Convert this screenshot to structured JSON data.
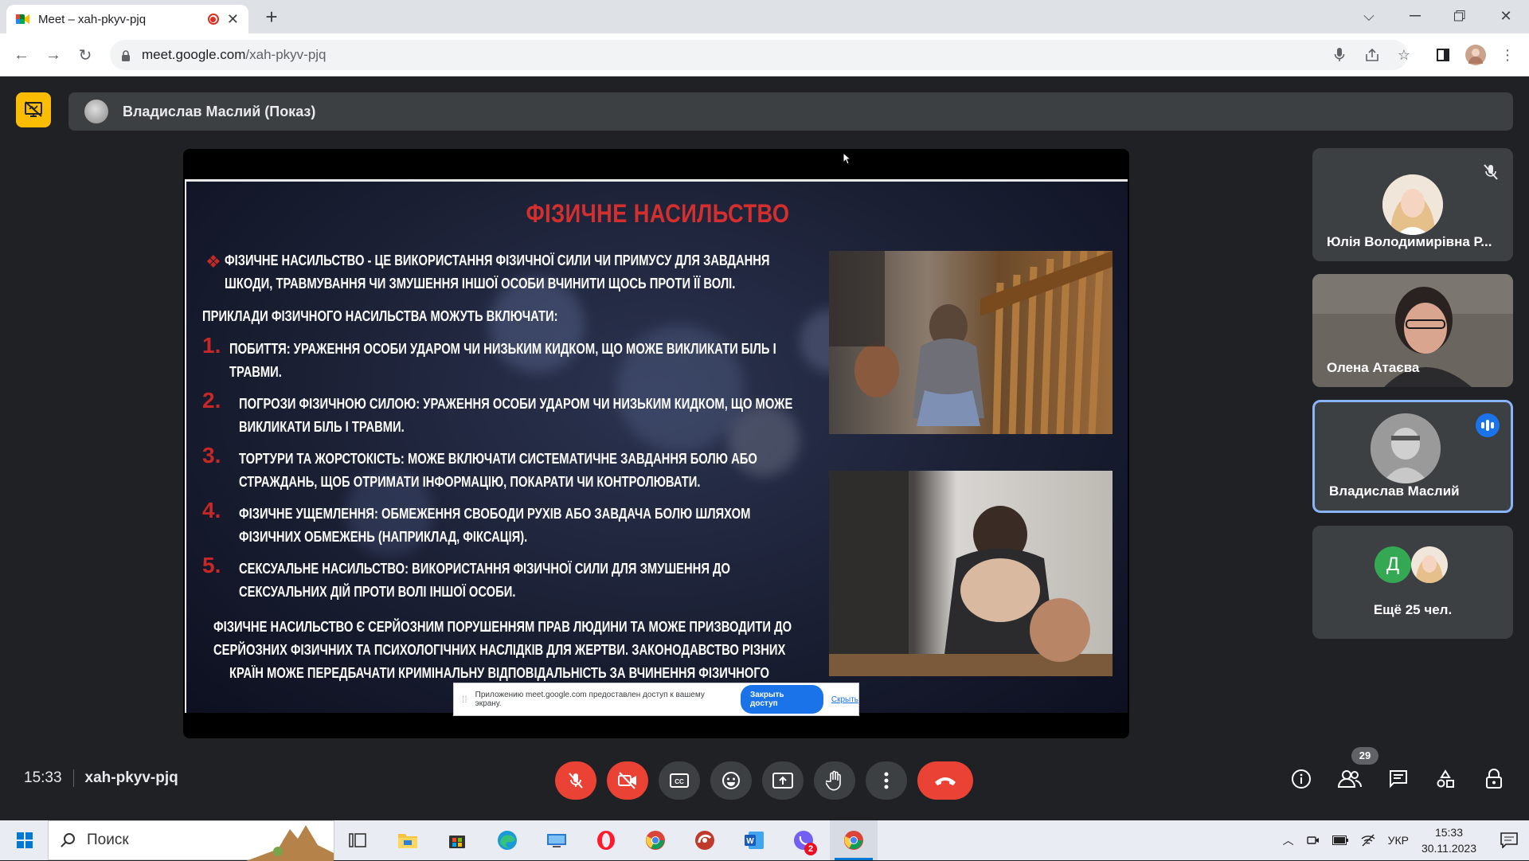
{
  "browser": {
    "tab_title": "Meet – xah-pkyv-pjq",
    "url_host": "meet.google.com",
    "url_path": "/xah-pkyv-pjq"
  },
  "presenter": {
    "label": "Владислав Маслий (Показ)"
  },
  "slide": {
    "title": "ФІЗИЧНЕ НАСИЛЬСТВО",
    "intro_line1": "ФІЗИЧНЕ НАСИЛЬСТВО - ЦЕ ВИКОРИСТАННЯ ФІЗИЧНОЇ СИЛИ ЧИ ПРИМУСУ ДЛЯ ЗАВДАННЯ",
    "intro_line2": "ШКОДИ, ТРАВМУВАННЯ ЧИ ЗМУШЕННЯ ІНШОЇ ОСОБИ ВЧИНИТИ ЩОСЬ ПРОТИ ЇЇ ВОЛІ.",
    "examples_heading": "ПРИКЛАДИ ФІЗИЧНОГО НАСИЛЬСТВА МОЖУТЬ ВКЛЮЧАТИ:",
    "items": [
      {
        "num": "1.",
        "line1": "ПОБИТТЯ:  УРАЖЕННЯ ОСОБИ УДАРОМ ЧИ НИЗЬКИМ КИДКОМ, ЩО МОЖЕ ВИКЛИКАТИ БІЛЬ І",
        "line2": "ТРАВМИ."
      },
      {
        "num": "2.",
        "line1": "ПОГРОЗИ ФІЗИЧНОЮ СИЛОЮ:  УРАЖЕННЯ ОСОБИ УДАРОМ ЧИ НИЗЬКИМ КИДКОМ, ЩО МОЖЕ",
        "line2": "ВИКЛИКАТИ БІЛЬ І ТРАВМИ."
      },
      {
        "num": "3.",
        "line1": "ТОРТУРИ ТА ЖОРСТОКІСТЬ: МОЖЕ ВКЛЮЧАТИ СИСТЕМАТИЧНЕ ЗАВДАННЯ БОЛЮ АБО",
        "line2": "СТРАЖДАНЬ, ЩОБ ОТРИМАТИ ІНФОРМАЦІЮ, ПОКАРАТИ ЧИ КОНТРОЛЮВАТИ."
      },
      {
        "num": "4.",
        "line1": "ФІЗИЧНЕ УЩЕМЛЕННЯ: ОБМЕЖЕННЯ СВОБОДИ РУХІВ АБО ЗАВДАЧА БОЛЮ ШЛЯХОМ",
        "line2": "ФІЗИЧНИХ ОБМЕЖЕНЬ (НАПРИКЛАД, ФІКСАЦІЯ)."
      },
      {
        "num": "5.",
        "line1": "СЕКСУАЛЬНЕ НАСИЛЬСТВО: ВИКОРИСТАННЯ ФІЗИЧНОЇ СИЛИ ДЛЯ ЗМУШЕННЯ ДО",
        "line2": "СЕКСУАЛЬНИХ ДІЙ ПРОТИ ВОЛІ ІНШОЇ ОСОБИ."
      }
    ],
    "conclusion_line1": "ФІЗИЧНЕ НАСИЛЬСТВО Є СЕРЙОЗНИМ ПОРУШЕННЯМ ПРАВ ЛЮДИНИ ТА МОЖЕ ПРИЗВОДИТИ ДО",
    "conclusion_line2": "СЕРЙОЗНИХ ФІЗИЧНИХ ТА ПСИХОЛОГІЧНИХ НАСЛІДКІВ ДЛЯ ЖЕРТВИ. ЗАКОНОДАВСТВО РІЗНИХ",
    "conclusion_line3": "КРАЇН МОЖЕ ПЕРЕДБАЧАТИ КРИМІНАЛЬНУ ВІДПОВІДАЛЬНІСТЬ ЗА ВЧИНЕННЯ ФІЗИЧНОГО"
  },
  "share_banner": {
    "text": "Приложению meet.google.com предоставлен доступ к вашему экрану.",
    "stop_label": "Закрыть доступ",
    "hide_label": "Скрыть"
  },
  "participants": {
    "p1_name": "Юлія Володимирівна Р...",
    "p2_name": "Олена Атаєва",
    "p3_name": "Владислав Маслий",
    "more_initial": "Д",
    "more_label": "Ещё 25 чел."
  },
  "meeting": {
    "time": "15:33",
    "code": "xah-pkyv-pjq",
    "people_count": "29"
  },
  "taskbar": {
    "search_placeholder": "Поиск",
    "lang": "УКР",
    "time": "15:33",
    "date": "30.11.2023",
    "viber_badge": "2"
  },
  "colors": {
    "meet_bg": "#202124",
    "tile_bg": "#3c4043",
    "danger": "#ea4335",
    "accent": "#1a73e8",
    "present_yellow": "#fbbc04",
    "slide_title_red": "#d32f2f"
  }
}
